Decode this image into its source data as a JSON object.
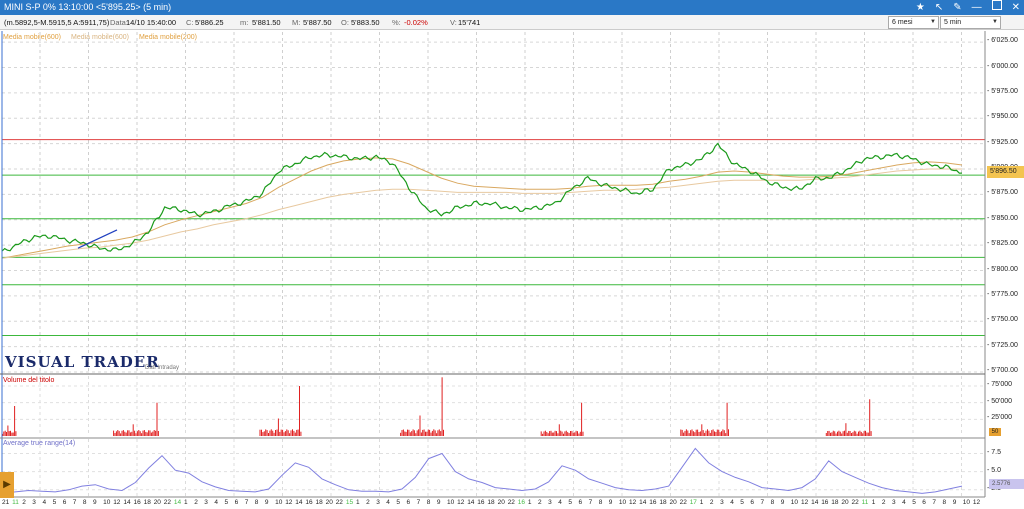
{
  "window": {
    "title": "MINI S-P 0% 13:10:00  <5'895.25> (5 min)"
  },
  "infobar": {
    "details": "(m.5892,5-M.5915,5 A:5911,75)",
    "date_label": "Data:",
    "date_value": "14/10 15:40:00",
    "close_label": "C:",
    "close_value": "5'886.25",
    "min_label": "m:",
    "min_value": "5'881.50",
    "max_label": "M:",
    "max_value": "5'887.50",
    "open_label": "O:",
    "open_value": "5'883.50",
    "pct_label": "%:",
    "pct_value": "-0.02%",
    "vol_label": "V:",
    "vol_value": "15'741",
    "period_select": "6 mesi",
    "interval_select": "5 min"
  },
  "legend": {
    "ma1": "Media mobile(600)",
    "ma2": "Media mobile(600)",
    "ma3": "Media mobile(200)"
  },
  "brand": {
    "name": "VISUAL TRADER",
    "sub": "Dati Intraday"
  },
  "price_axis": {
    "ticks": [
      "6'025.00",
      "6'000.00",
      "5'975.00",
      "5'950.00",
      "5'925.00",
      "5'900.00",
      "5'875.00",
      "5'850.00",
      "5'825.00",
      "5'800.00",
      "5'775.00",
      "5'750.00",
      "5'725.00",
      "5'700.00"
    ],
    "current_value": "5'896.50"
  },
  "volume_panel": {
    "title": "Volume del titolo",
    "ticks": [
      "75'000",
      "50'000",
      "25'000"
    ],
    "flag": "50"
  },
  "atr_panel": {
    "title": "Average true range(14)",
    "ticks": [
      "7.5",
      "5.0",
      "2.5"
    ],
    "current_value": "2.5776"
  },
  "colors": {
    "titlebar": "#2a78c6",
    "price_line": "#1a9a1a",
    "support_lines": "#3cb83c",
    "resistance_line": "#e04040",
    "moving_average": "#d9a860",
    "volume_bars": "#e02020",
    "atr_line": "#8080e0"
  },
  "chart_data": [
    {
      "type": "line",
      "title": "MINI S-P 0% 13:10:00  <5'895.25> (5 min)",
      "ylim": [
        5700,
        6035
      ],
      "series": [
        {
          "name": "",
          "values": [
            5818,
            5826,
            5833,
            5834,
            5830,
            5827,
            5822,
            5820,
            5826,
            5838,
            5862,
            5860,
            5855,
            5858,
            5864,
            5868,
            5876,
            5898,
            5905,
            5912,
            5914,
            5912,
            5910,
            5912,
            5906,
            5882,
            5862,
            5855,
            5862,
            5866,
            5866,
            5862,
            5860,
            5862,
            5866,
            5880,
            5891,
            5884,
            5880,
            5876,
            5880,
            5900,
            5904,
            5910,
            5924,
            5905,
            5898,
            5888,
            5882,
            5880,
            5890,
            5892,
            5900,
            5910,
            5912,
            5914,
            5910,
            5904,
            5902,
            5896
          ]
        },
        {
          "name": "Media mobile(600)",
          "values": [
            5812,
            5815,
            5818,
            5821,
            5824,
            5826,
            5828,
            5830,
            5833,
            5838,
            5845,
            5850,
            5854,
            5858,
            5862,
            5866,
            5872,
            5882,
            5890,
            5898,
            5904,
            5908,
            5910,
            5911,
            5910,
            5905,
            5898,
            5891,
            5886,
            5883,
            5882,
            5881,
            5880,
            5880,
            5880,
            5881,
            5883,
            5884,
            5884,
            5884,
            5885,
            5888,
            5890,
            5893,
            5897,
            5898,
            5897,
            5895,
            5893,
            5892,
            5892,
            5893,
            5895,
            5898,
            5901,
            5904,
            5906,
            5907,
            5906,
            5904
          ]
        },
        {
          "name": "Media mobile(200)",
          "values": [
            5812,
            5814,
            5816,
            5818,
            5820,
            5822,
            5823,
            5825,
            5827,
            5830,
            5834,
            5838,
            5841,
            5845,
            5848,
            5851,
            5855,
            5860,
            5864,
            5868,
            5872,
            5875,
            5877,
            5879,
            5880,
            5880,
            5879,
            5878,
            5877,
            5877,
            5877,
            5877,
            5876,
            5876,
            5876,
            5877,
            5878,
            5879,
            5879,
            5880,
            5881,
            5882,
            5884,
            5886,
            5888,
            5889,
            5889,
            5889,
            5889,
            5889,
            5890,
            5891,
            5892,
            5894,
            5896,
            5898,
            5899,
            5900,
            5900,
            5900
          ]
        }
      ],
      "horizontal_levels": {
        "resistance": [
          5929
        ],
        "supports": [
          5894,
          5851,
          5813,
          5786,
          5736
        ]
      }
    },
    {
      "type": "bar",
      "title": "Volume del titolo",
      "ylim": [
        0,
        90000
      ],
      "sessions": [
        {
          "x_start": 0.0,
          "x_end": 0.015,
          "peak": 45000,
          "base": 8000
        },
        {
          "x_start": 0.113,
          "x_end": 0.16,
          "peak": 50000,
          "base": 9000
        },
        {
          "x_start": 0.262,
          "x_end": 0.305,
          "peak": 75000,
          "base": 10000
        },
        {
          "x_start": 0.405,
          "x_end": 0.45,
          "peak": 88000,
          "base": 10000
        },
        {
          "x_start": 0.548,
          "x_end": 0.592,
          "peak": 50000,
          "base": 8000
        },
        {
          "x_start": 0.69,
          "x_end": 0.74,
          "peak": 50000,
          "base": 10000
        },
        {
          "x_start": 0.838,
          "x_end": 0.885,
          "peak": 55000,
          "base": 8000
        }
      ]
    },
    {
      "type": "line",
      "title": "Average true range(14)",
      "ylim": [
        1.5,
        9.5
      ],
      "series": [
        {
          "name": "Average true range(14)",
          "values": [
            2.0,
            2.2,
            2.4,
            2.3,
            2.2,
            2.5,
            3.0,
            3.2,
            2.6,
            2.4,
            3.5,
            5.5,
            7.2,
            5.2,
            4.8,
            3.6,
            2.9,
            2.4,
            2.3,
            2.2,
            2.6,
            4.5,
            6.2,
            5.6,
            4.0,
            3.2,
            2.5,
            2.3,
            2.3,
            2.2,
            2.6,
            4.2,
            6.8,
            7.5,
            5.0,
            4.0,
            3.5,
            2.8,
            2.6,
            2.4,
            2.6,
            3.6,
            5.8,
            5.2,
            4.0,
            3.4,
            2.8,
            2.5,
            2.4,
            2.6,
            3.0,
            5.6,
            8.2,
            6.2,
            5.0,
            4.2,
            3.6,
            2.8,
            2.6,
            2.4,
            2.8,
            4.0,
            6.5,
            5.0,
            4.2,
            3.4,
            2.8,
            2.4,
            2.2,
            2.0,
            2.2,
            2.6,
            3.0
          ]
        }
      ]
    }
  ],
  "x_axis": {
    "labels": [
      "21",
      "11",
      "2",
      "3",
      "4",
      "5",
      "6",
      "7",
      "8",
      "9",
      "10",
      "12",
      "14",
      "16",
      "18",
      "20",
      "22",
      "14",
      "1",
      "2",
      "3",
      "4",
      "5",
      "6",
      "7",
      "8",
      "9",
      "10",
      "12",
      "14",
      "16",
      "18",
      "20",
      "22",
      "15",
      "1",
      "2",
      "3",
      "4",
      "5",
      "6",
      "7",
      "8",
      "9",
      "10",
      "12",
      "14",
      "16",
      "18",
      "20",
      "22",
      "16",
      "1",
      "2",
      "3",
      "4",
      "5",
      "6",
      "7",
      "8",
      "9",
      "10",
      "12",
      "14",
      "16",
      "18",
      "20",
      "22",
      "17",
      "1",
      "2",
      "3",
      "4",
      "5",
      "6",
      "7",
      "8",
      "9",
      "10",
      "12",
      "14",
      "16",
      "18",
      "20",
      "22",
      "11",
      "1",
      "2",
      "3",
      "4",
      "5",
      "6",
      "7",
      "8",
      "9",
      "10",
      "12"
    ],
    "highlighted": [
      "11",
      "14",
      "15",
      "16",
      "17"
    ]
  }
}
